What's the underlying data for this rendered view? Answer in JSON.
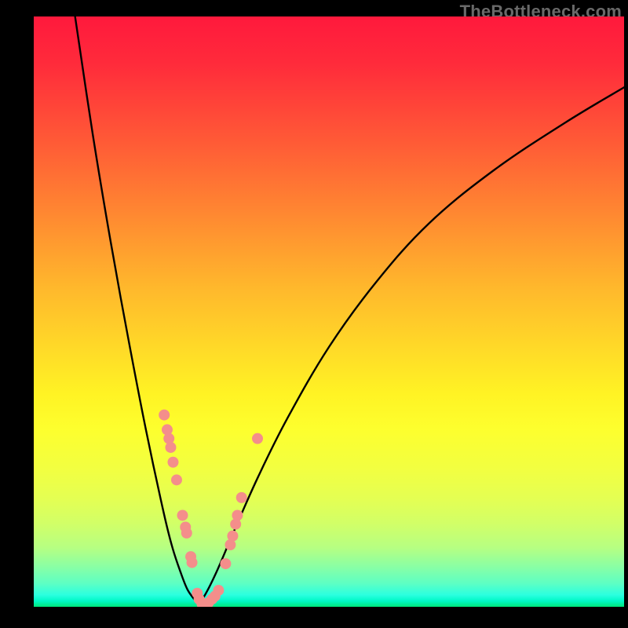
{
  "watermark": {
    "text": "TheBottleneck.com"
  },
  "chart_data": {
    "type": "line",
    "title": "",
    "xlabel": "",
    "ylabel": "",
    "xlim": [
      0,
      100
    ],
    "ylim": [
      0,
      100
    ],
    "grid": false,
    "gradient": {
      "top_color": "#ff193c",
      "mid_color": "#fff324",
      "bottom_color": "#00e77b"
    },
    "series": [
      {
        "name": "bottleneck-curve-left",
        "x": [
          7.0,
          10.0,
          13.0,
          16.0,
          19.0,
          22.0,
          23.5,
          25.0,
          26.0,
          27.0,
          27.8
        ],
        "y": [
          100.0,
          80.0,
          62.0,
          45.5,
          30.0,
          16.0,
          10.0,
          5.5,
          3.0,
          1.5,
          0.5
        ]
      },
      {
        "name": "bottleneck-curve-right",
        "x": [
          27.8,
          29.0,
          31.0,
          34.0,
          38.0,
          43.0,
          50.0,
          58.0,
          67.0,
          78.0,
          90.0,
          100.0
        ],
        "y": [
          0.5,
          2.0,
          6.0,
          13.0,
          22.0,
          32.0,
          44.0,
          55.0,
          65.0,
          74.0,
          82.0,
          88.0
        ]
      }
    ],
    "points": {
      "name": "highlighted-points",
      "color": "#f48e8b",
      "radius_px": 7,
      "items": [
        {
          "x": 22.1,
          "y": 32.5
        },
        {
          "x": 22.6,
          "y": 30.0
        },
        {
          "x": 22.9,
          "y": 28.5
        },
        {
          "x": 23.2,
          "y": 27.0
        },
        {
          "x": 23.6,
          "y": 24.5
        },
        {
          "x": 24.2,
          "y": 21.5
        },
        {
          "x": 25.2,
          "y": 15.5
        },
        {
          "x": 25.7,
          "y": 13.5
        },
        {
          "x": 25.9,
          "y": 12.5
        },
        {
          "x": 26.6,
          "y": 8.5
        },
        {
          "x": 26.8,
          "y": 7.5
        },
        {
          "x": 27.7,
          "y": 2.3
        },
        {
          "x": 28.0,
          "y": 1.3
        },
        {
          "x": 28.5,
          "y": 0.5
        },
        {
          "x": 29.1,
          "y": 0.5
        },
        {
          "x": 29.6,
          "y": 0.7
        },
        {
          "x": 30.2,
          "y": 1.3
        },
        {
          "x": 30.7,
          "y": 1.8
        },
        {
          "x": 31.3,
          "y": 2.8
        },
        {
          "x": 32.5,
          "y": 7.3
        },
        {
          "x": 33.3,
          "y": 10.5
        },
        {
          "x": 33.7,
          "y": 12.0
        },
        {
          "x": 34.2,
          "y": 14.0
        },
        {
          "x": 34.5,
          "y": 15.5
        },
        {
          "x": 35.2,
          "y": 18.5
        },
        {
          "x": 37.9,
          "y": 28.5
        }
      ]
    }
  }
}
